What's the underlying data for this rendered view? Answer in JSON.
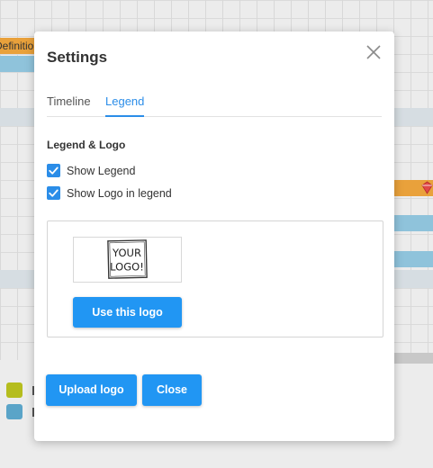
{
  "background": {
    "bar_label": "Definition",
    "colors": {
      "orange": "#e9a13b",
      "blue": "#8fc3db",
      "legend_olive": "#b5bd1e",
      "legend_blue": "#5aa4c8",
      "diamond": "#e04848"
    }
  },
  "modal": {
    "title": "Settings",
    "tabs": [
      {
        "label": "Timeline",
        "active": false
      },
      {
        "label": "Legend",
        "active": true
      }
    ],
    "section_title": "Legend & Logo",
    "checkboxes": [
      {
        "label": "Show Legend",
        "checked": true
      },
      {
        "label": "Show Logo in legend",
        "checked": true
      }
    ],
    "logo_panel": {
      "logo_text_line1": "YOUR",
      "logo_text_line2": "LOGO!",
      "use_button": "Use this logo"
    },
    "footer": {
      "upload_button": "Upload logo",
      "close_button": "Close"
    },
    "icons": {
      "close": "close-icon",
      "check": "check-icon"
    },
    "accent_color": "#2196f3"
  }
}
